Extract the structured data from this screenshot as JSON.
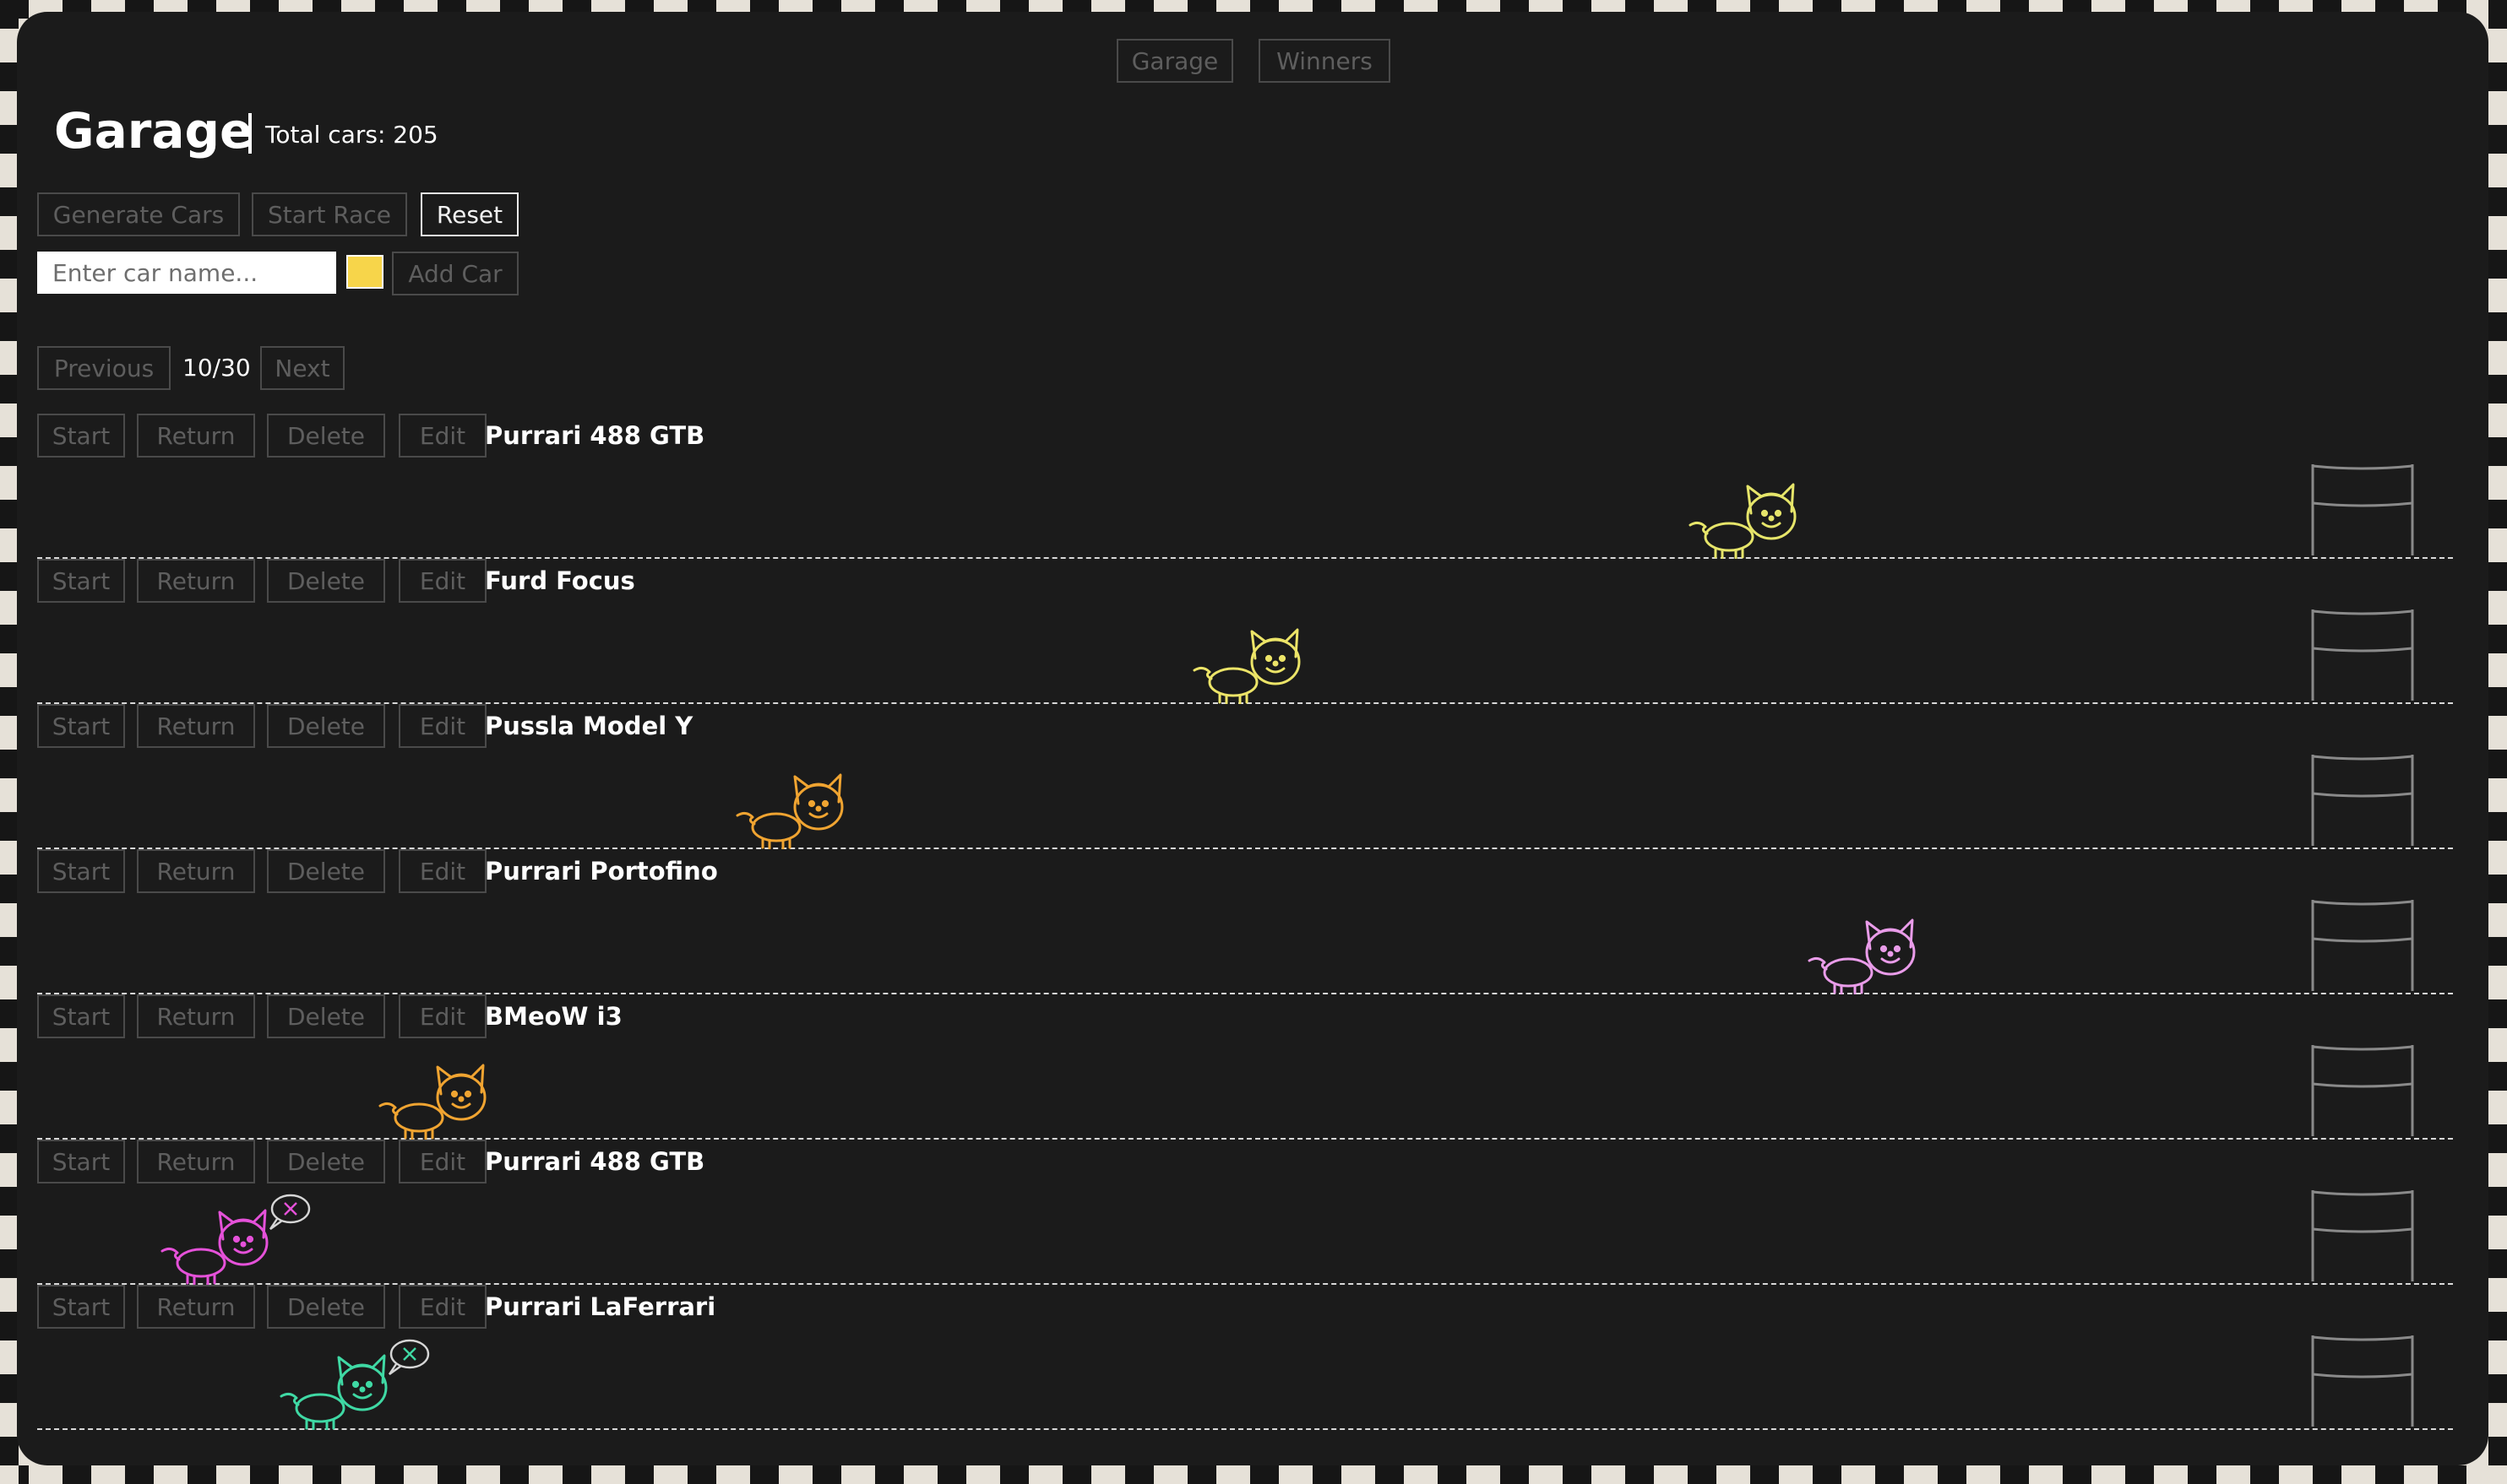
{
  "nav": {
    "garage_label": "Garage",
    "winners_label": "Winners"
  },
  "header": {
    "title": "Garage",
    "total_cars": "Total cars: 205"
  },
  "controls": {
    "generate_label": "Generate Cars",
    "start_race_label": "Start Race",
    "reset_label": "Reset",
    "name_placeholder": "Enter car name...",
    "name_value": "",
    "selected_color": "#f7d54a",
    "add_car_label": "Add Car"
  },
  "pagination": {
    "previous_label": "Previous",
    "page": "10/30",
    "next_label": "Next"
  },
  "track_buttons": {
    "start": "Start",
    "return": "Return",
    "delete": "Delete",
    "edit": "Edit"
  },
  "cars": [
    {
      "name": "Purrari 488 GTB",
      "color": "#e6e56a",
      "progress": 0.78,
      "crashed": false
    },
    {
      "name": "Furd Focus",
      "color": "#ece468",
      "progress": 0.53,
      "crashed": false
    },
    {
      "name": "Pussla Model Y",
      "color": "#f0a431",
      "progress": 0.3,
      "crashed": false
    },
    {
      "name": "Purrari Portofino",
      "color": "#e99ce9",
      "progress": 0.84,
      "crashed": false
    },
    {
      "name": "BMeoW i3",
      "color": "#f0a431",
      "progress": 0.12,
      "crashed": false
    },
    {
      "name": "Purrari 488 GTB",
      "color": "#e551d9",
      "progress": 0.01,
      "crashed": true
    },
    {
      "name": "Purrari LaFerrari",
      "color": "#3fd9a4",
      "progress": 0.07,
      "crashed": true
    }
  ],
  "colors": {
    "panel_bg": "#1b1b1b",
    "frame_checker": "#e6e1d8",
    "finish_flag": "#8a8a8a"
  }
}
